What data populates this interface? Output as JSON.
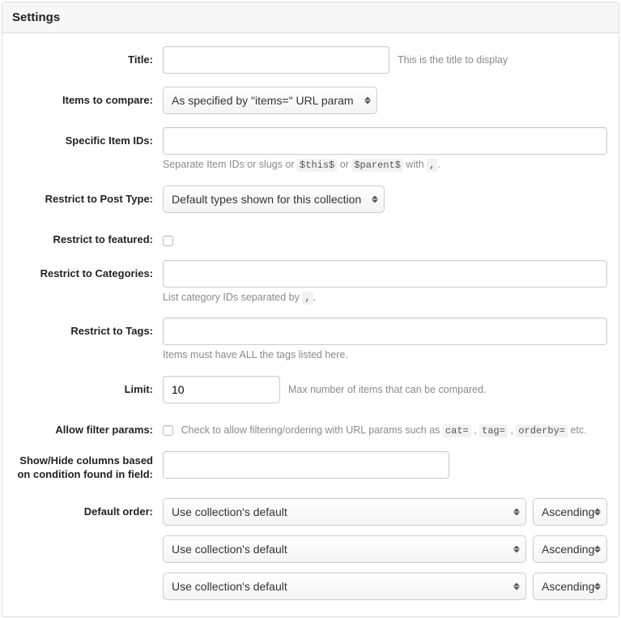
{
  "panel": {
    "title": "Settings"
  },
  "fields": {
    "title": {
      "label": "Title:",
      "value": "",
      "hint": "This is the title to display"
    },
    "itemsToCompare": {
      "label": "Items to compare:",
      "selected": "As specified by \"items=\" URL param"
    },
    "specificItemIds": {
      "label": "Specific Item IDs:",
      "value": "",
      "hint_a": "Separate Item IDs or slugs or ",
      "hint_code1": "$this$",
      "hint_b": " or ",
      "hint_code2": "$parent$",
      "hint_c": " with ",
      "hint_code3": ",",
      "hint_d": "."
    },
    "restrictPostType": {
      "label": "Restrict to Post Type:",
      "selected": "Default types shown for this collection"
    },
    "restrictFeatured": {
      "label": "Restrict to featured:",
      "checked": false
    },
    "restrictCategories": {
      "label": "Restrict to Categories:",
      "value": "",
      "hint_a": "List category IDs separated by ",
      "hint_code": ",",
      "hint_b": "."
    },
    "restrictTags": {
      "label": "Restrict to Tags:",
      "value": "",
      "hint": "Items must have ALL the tags listed here."
    },
    "limit": {
      "label": "Limit:",
      "value": "10",
      "hint": "Max number of items that can be compared."
    },
    "allowFilter": {
      "label": "Allow filter params:",
      "checked": false,
      "hint_a": "Check to allow filtering/ordering with URL params such as ",
      "hint_code1": "cat=",
      "hint_comma": " , ",
      "hint_code2": "tag=",
      "hint_code3": "orderby=",
      "hint_b": " etc."
    },
    "showHide": {
      "label": "Show/Hide columns based on condition found in field:",
      "value": ""
    },
    "defaultOrder": {
      "label": "Default order:",
      "rows": [
        {
          "by": "Use collection's default",
          "dir": "Ascending"
        },
        {
          "by": "Use collection's default",
          "dir": "Ascending"
        },
        {
          "by": "Use collection's default",
          "dir": "Ascending"
        }
      ]
    }
  }
}
